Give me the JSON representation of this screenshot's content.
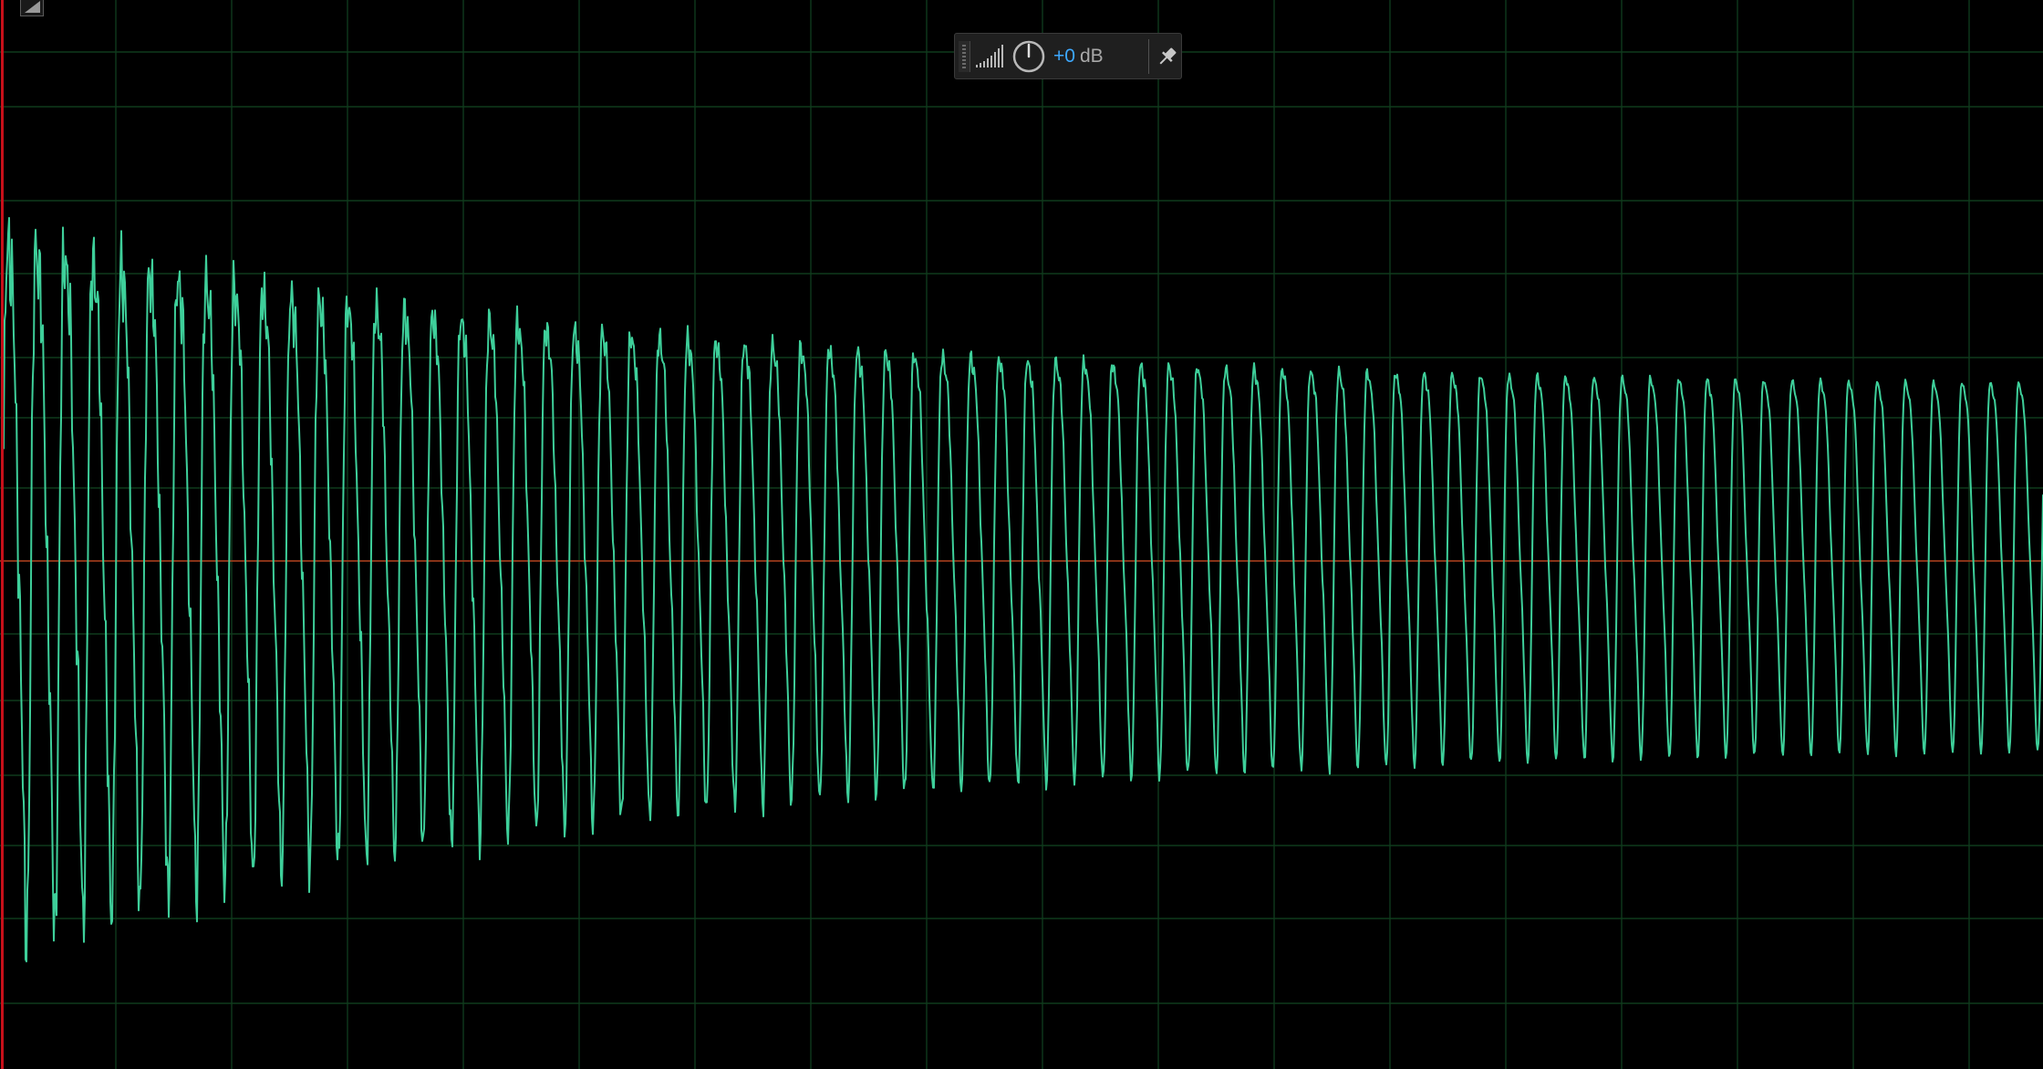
{
  "view": {
    "name": "waveform editor",
    "colors": {
      "background": "#000000",
      "grid": "#0f3a1c",
      "waveform": "#3ecf9a",
      "baseline": "#b03a1a",
      "playhead": "#c8101a"
    },
    "grid": true,
    "baseline_visible": true
  },
  "hud": {
    "gain_value": "+0",
    "gain_unit": "dB",
    "icons": [
      "grip-handle-icon",
      "volume-meter-icon",
      "power-knob-icon",
      "pin-icon"
    ]
  },
  "corner_toggle": {
    "icon": "corner-triangle-icon"
  },
  "waveform": {
    "description_type": "decaying oscillation",
    "cycles_visible": 72,
    "initial_amplitude": 0.93,
    "sustain_amplitude": 0.47,
    "dc_offset": 0.05,
    "decay_rate": 3.2,
    "glitch_amount": 0.3
  }
}
